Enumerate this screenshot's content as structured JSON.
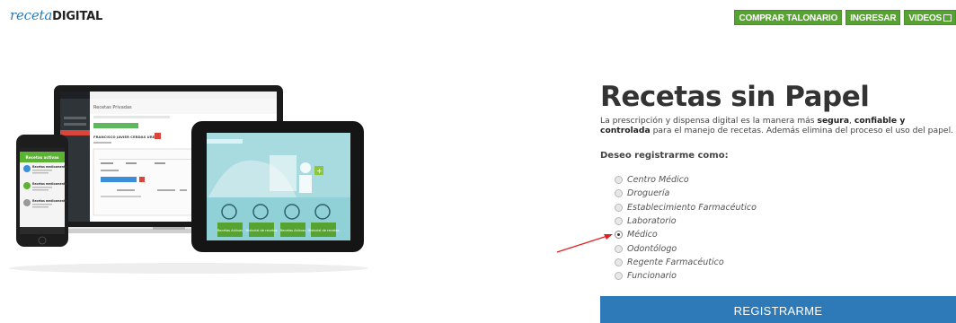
{
  "logo": {
    "part1": "receta",
    "part2": "DIGITAL"
  },
  "nav": {
    "buy_label": "COMPRAR TALONARIO",
    "login_label": "INGRESAR",
    "videos_label": "VIDEOS"
  },
  "hero": {
    "headline": "Recetas sin Papel",
    "desc_1": "La prescripción y dispensa digital es la manera más ",
    "desc_b1": "segura",
    "desc_2": ", ",
    "desc_b2": "confiable y controlada",
    "desc_3": " para el manejo de recetas. Además elimina del proceso el uso del papel."
  },
  "form": {
    "question": "Deseo registrarme como:",
    "options": [
      {
        "label": "Centro Médico",
        "checked": false
      },
      {
        "label": "Droguería",
        "checked": false
      },
      {
        "label": "Establecimiento Farmacéutico",
        "checked": false
      },
      {
        "label": "Laboratorio",
        "checked": false
      },
      {
        "label": "Médico",
        "checked": true
      },
      {
        "label": "Odontólogo",
        "checked": false
      },
      {
        "label": "Regente Farmacéutico",
        "checked": false
      },
      {
        "label": "Funcionario",
        "checked": false
      }
    ],
    "submit_label": "REGISTRARME"
  },
  "illustration": {
    "laptop_title": "Recetas Privadas",
    "laptop_patient": "FRANCISCO JAVIER CERDAS UREÑA",
    "laptop_header": "RECETA ELECTR",
    "phone_header": "Recetas activas",
    "phone_items": [
      "Recetas medicamento",
      "Recetas medicamento",
      "Recetas medicamento"
    ],
    "tablet_buttons": [
      "Recetas Activas",
      "Historial de recetas",
      "Recetas Activas",
      "Historial de recetas"
    ]
  },
  "colors": {
    "brand_blue": "#2d79b7",
    "nav_green": "#57a331",
    "submit_blue": "#2e7ab8",
    "annotation_red": "#e02020"
  }
}
